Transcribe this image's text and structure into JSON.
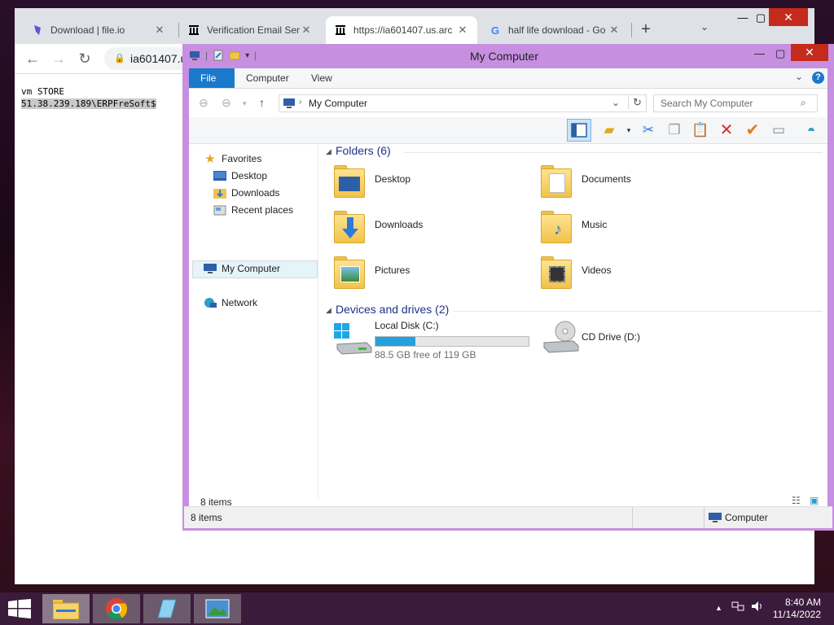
{
  "browser": {
    "tabs": [
      {
        "label": "Download | file.io",
        "icon": "fileio-icon"
      },
      {
        "label": "Verification Email Sent",
        "icon": "archive-icon"
      },
      {
        "label": "https://ia601407.us.arc",
        "icon": "archive-icon"
      },
      {
        "label": "half life download - Go",
        "icon": "google-icon"
      }
    ],
    "address": "ia601407.u",
    "content_lines": [
      "vm STORE",
      "51.38.239.189\\ERPFreSoft$"
    ]
  },
  "explorer": {
    "title": "My Computer",
    "ribbon_tabs": [
      "File",
      "Computer",
      "View"
    ],
    "address_path": "My Computer",
    "search_placeholder": "Search My Computer",
    "nav": {
      "favorites": "Favorites",
      "favorites_items": [
        "Desktop",
        "Downloads",
        "Recent places"
      ],
      "my_computer": "My Computer",
      "network": "Network"
    },
    "folders_header": "Folders (6)",
    "folders": [
      "Desktop",
      "Documents",
      "Downloads",
      "Music",
      "Pictures",
      "Videos"
    ],
    "drives_header": "Devices and drives (2)",
    "drives": [
      {
        "name": "Local Disk (C:)",
        "free": "88.5 GB free of 119 GB",
        "used_fraction": 0.26
      },
      {
        "name": "CD Drive (D:)"
      }
    ],
    "items_count": "8 items",
    "status_items": "8 items",
    "status_location": "Computer"
  },
  "taskbar": {
    "time": "8:40 AM",
    "date": "11/14/2022"
  },
  "colors": {
    "accent": "#1979ca",
    "explorer_frame": "#c78fe0",
    "close": "#c42b1c",
    "progress": "#26a0da"
  }
}
